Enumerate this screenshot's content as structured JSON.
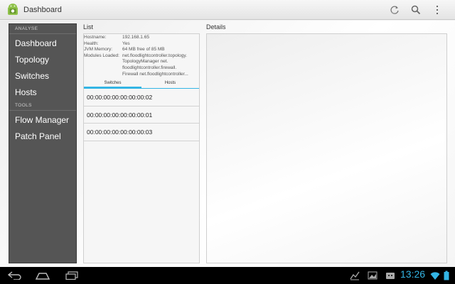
{
  "app": {
    "title": "Dashboard",
    "accent": "#33b5e5"
  },
  "actionbar": {
    "icons": [
      "refresh-icon",
      "search-icon",
      "overflow-menu-icon"
    ]
  },
  "sidebar": {
    "sections": [
      {
        "label": "ANALYSE",
        "items": [
          "Dashboard",
          "Topology",
          "Switches",
          "Hosts"
        ]
      },
      {
        "label": "TOOLS",
        "items": [
          "Flow Manager",
          "Patch Panel"
        ]
      }
    ]
  },
  "list": {
    "title": "List",
    "info": {
      "hostname_label": "Hostname:",
      "hostname_value": "192.168.1.65",
      "health_label": "Health:",
      "health_value": "Yes",
      "memory_label": "JVM Memory:",
      "memory_value": "64 MB free of 85 MB",
      "modules_label": "Modules Loaded:",
      "modules_value_1": "net.floodlightcontroller.topology.",
      "modules_value_2": "TopologyManager net.",
      "modules_value_3": "floodlightcontroller.firewall.",
      "modules_value_4": "Firewall net.floodlightcontroller..."
    },
    "tabs": [
      {
        "label": "Switches",
        "active": true
      },
      {
        "label": "Hosts",
        "active": false
      }
    ],
    "switches": [
      "00:00:00:00:00:00:00:02",
      "00:00:00:00:00:00:00:01",
      "00:00:00:00:00:00:00:03"
    ]
  },
  "details": {
    "title": "Details"
  },
  "systembar": {
    "clock": "13:26",
    "nav_icons": [
      "back-icon",
      "home-icon",
      "recent-apps-icon"
    ],
    "status_icons": [
      "chart-icon",
      "photo-icon",
      "android-notification-icon",
      "wifi-icon",
      "battery-icon"
    ]
  }
}
